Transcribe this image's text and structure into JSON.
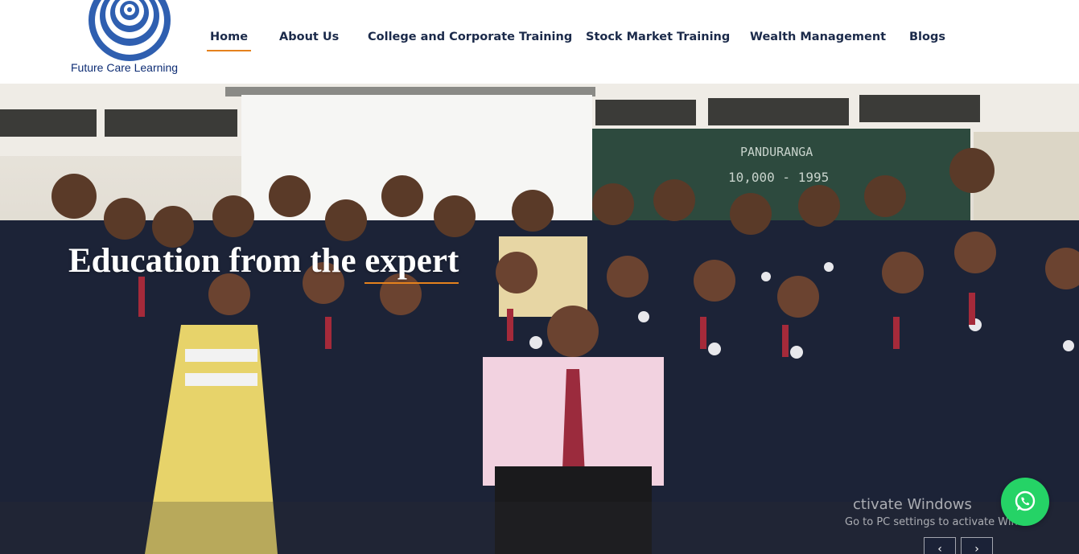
{
  "brand": {
    "name": "Future Care Learning",
    "logo_icon": "spiral-logo-icon",
    "colors": {
      "primary": "#2f5fb0",
      "navy": "#1b2a4a",
      "accent": "#e5821d"
    }
  },
  "nav": {
    "items": [
      {
        "label": "Home",
        "active": true
      },
      {
        "label": "About Us",
        "active": false
      },
      {
        "label": "College and Corporate Training",
        "active": false
      },
      {
        "label": "Stock Market Training",
        "active": false
      },
      {
        "label": "Wealth Management",
        "active": false
      },
      {
        "label": "Blogs",
        "active": false
      }
    ]
  },
  "hero": {
    "headline_part1": "Education from the ",
    "headline_part2": "expert",
    "image": "group-photo-students-in-blazers"
  },
  "overlay": {
    "watermark_line1": "ctivate Windows",
    "watermark_line2": "Go to PC settings to activate Windo",
    "whatsapp_icon": "whatsapp-icon",
    "whatsapp_color": "#25d366"
  },
  "slider": {
    "prev_icon": "chevron-left-icon",
    "next_icon": "chevron-right-icon"
  }
}
